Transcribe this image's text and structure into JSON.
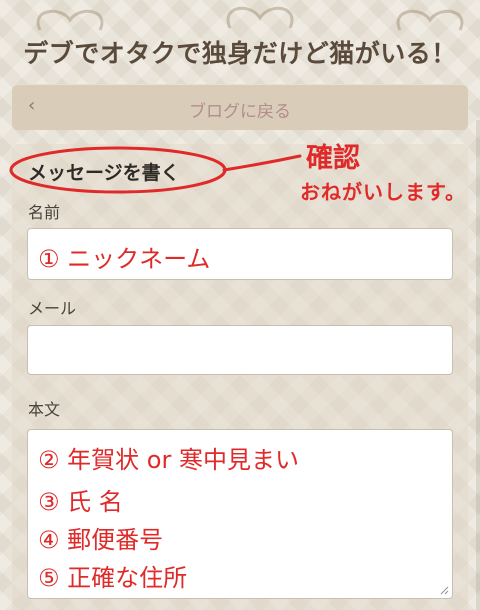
{
  "header": {
    "title": "デブでオタクで独身だけど猫がいる！"
  },
  "nav": {
    "back_chevron": "‹",
    "back_label": "ブログに戻る"
  },
  "form": {
    "heading": "メッセージを書く",
    "name_label": "名前",
    "mail_label": "メール",
    "body_label": "本文"
  },
  "annotations": {
    "note_line1": "確認",
    "note_line2": "おねがいします。",
    "name_entry": "① ニックネーム",
    "body_entries": [
      "② 年賀状 or 寒中見まい",
      "③ 氏 名",
      "④ 郵便番号",
      "⑤ 正確な住所"
    ]
  },
  "colors": {
    "annotation": "#e02a2a",
    "title": "#5a4a3c",
    "back_label": "#b48c8c",
    "background": "#e9e3d6"
  }
}
